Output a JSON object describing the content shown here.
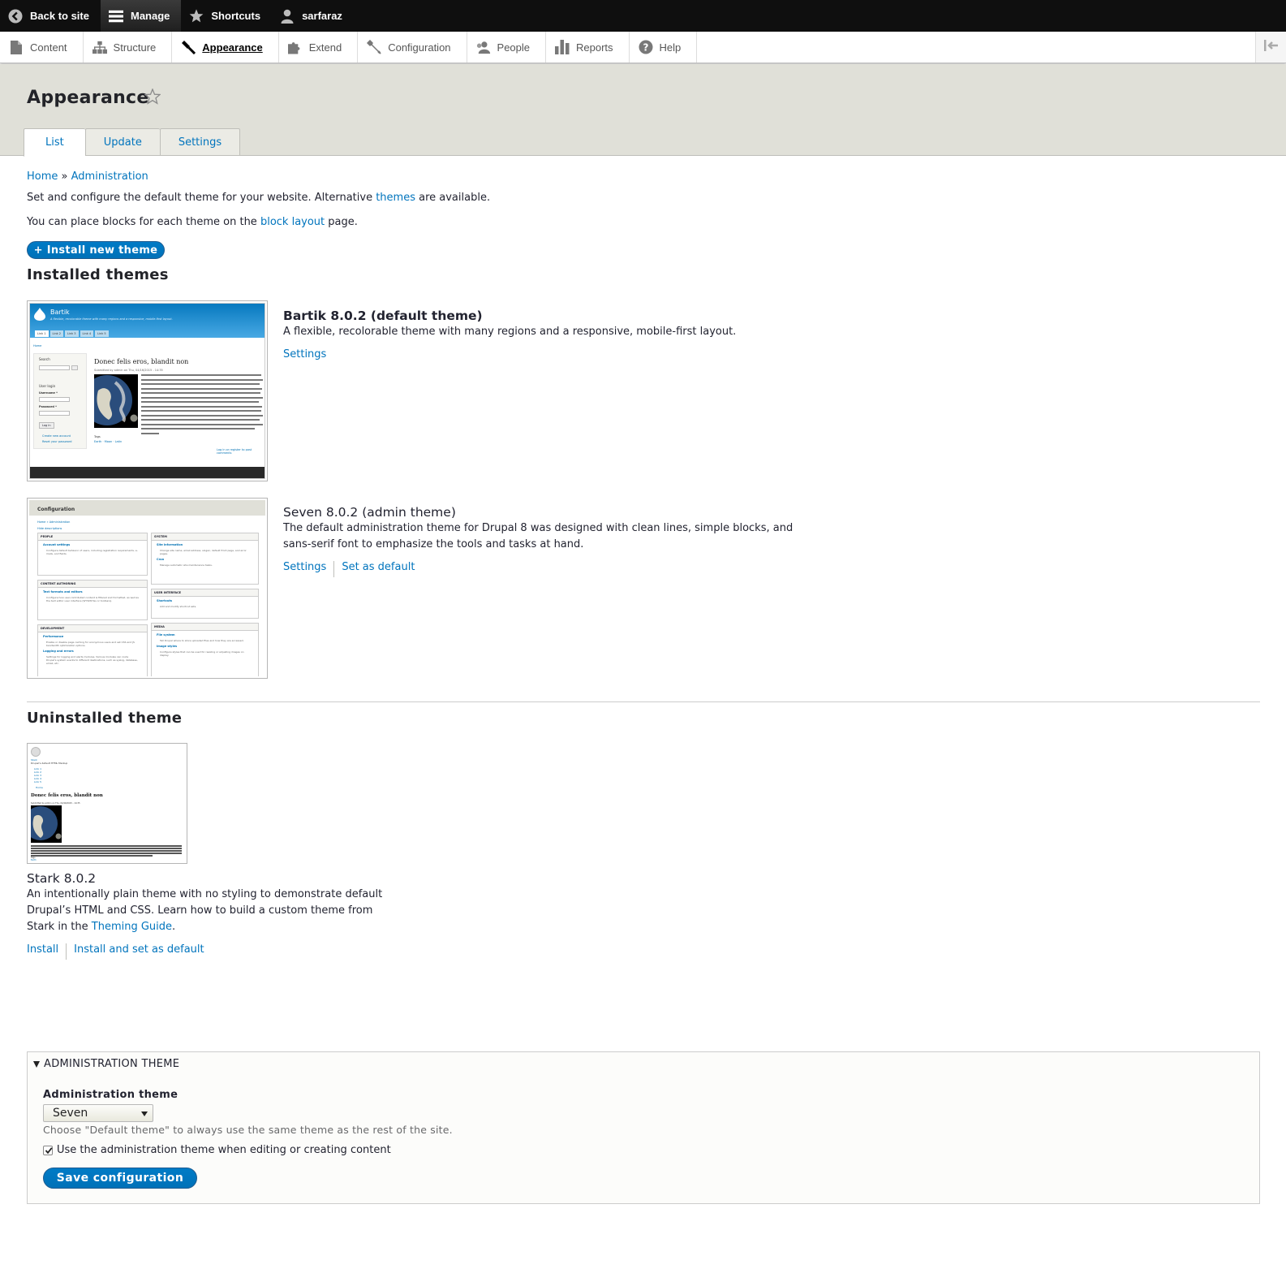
{
  "toolbar": {
    "back_label": "Back to site",
    "manage_label": "Manage",
    "shortcuts_label": "Shortcuts",
    "user_label": "sarfaraz"
  },
  "tray": {
    "items": [
      {
        "label": "Content",
        "icon": "file-icon"
      },
      {
        "label": "Structure",
        "icon": "sitemap-icon"
      },
      {
        "label": "Appearance",
        "icon": "paintbrush-icon",
        "active": true
      },
      {
        "label": "Extend",
        "icon": "puzzle-icon"
      },
      {
        "label": "Configuration",
        "icon": "wrench-icon"
      },
      {
        "label": "People",
        "icon": "person-icon"
      },
      {
        "label": "Reports",
        "icon": "bar-chart-icon"
      },
      {
        "label": "Help",
        "icon": "help-icon"
      }
    ]
  },
  "header": {
    "title": "Appearance",
    "tabs": [
      "List",
      "Update",
      "Settings"
    ]
  },
  "breadcrumb": {
    "home": "Home",
    "separator": "»",
    "admin": "Administration"
  },
  "intro": {
    "p1_before": "Set and configure the default theme for your website. Alternative ",
    "p1_link": "themes",
    "p1_after": " are available.",
    "p2_before": "You can place blocks for each theme on the ",
    "p2_link": "block layout",
    "p2_after": " page."
  },
  "install_button": "+ Install new theme",
  "installed": {
    "heading": "Installed themes",
    "themes": [
      {
        "name": "Bartik 8.0.2 (default theme)",
        "description": "A flexible, recolorable theme with many regions and a responsive, mobile-first layout.",
        "links": [
          "Settings"
        ]
      },
      {
        "name": "Seven 8.0.2 (admin theme)",
        "description_line1": "The default administration theme for Drupal 8 was designed with clean lines, simple blocks, and",
        "description_line2": "sans-serif font to emphasize the tools and tasks at hand.",
        "links": [
          "Settings",
          "Set as default"
        ]
      }
    ]
  },
  "bartik_preview": {
    "site_name": "Bartik",
    "slogan": "A flexible, recolorable theme with many regions and a responsive, mobile-first layout.",
    "tabs": [
      "Link 1",
      "Link 2",
      "Link 3",
      "Link 4",
      "Link 5"
    ],
    "crumb": "Home",
    "search": "Search",
    "login_title": "User login",
    "username": "Username *",
    "password": "Password *",
    "login_btn": "Log in",
    "create": "Create new account",
    "reset": "Reset your password",
    "article_title": "Donec felis eros, blandit non",
    "submitted": "Submitted by admin on Thu, 04/16/2015 - 14:35",
    "tags": "Tags",
    "tag_links": "Earth · Moon · Latin",
    "footer_link": "Log in or register to post comments"
  },
  "seven_preview": {
    "title": "Configuration",
    "crumb": "Home » Administration",
    "hide": "Hide descriptions",
    "left": [
      {
        "heading": "PEOPLE",
        "items": [
          {
            "t": "Account settings",
            "d": "Configure default behavior of users, including registration requirements, e-mails, and fields."
          }
        ]
      },
      {
        "heading": "CONTENT AUTHORING",
        "items": [
          {
            "t": "Text formats and editors",
            "d": "Configure how user-contributed content is filtered and formatted, as well as the text editor user interface (WYSIWYGs or toolbars)."
          }
        ]
      },
      {
        "heading": "DEVELOPMENT",
        "items": [
          {
            "t": "Performance",
            "d": "Enable or disable page caching for anonymous users and set CSS and JS bandwidth optimization options."
          },
          {
            "t": "Logging and errors",
            "d": "Settings for logging and alerts modules. Various modules can route Drupal's system events to different destinations, such as syslog, database, email, etc."
          }
        ]
      }
    ],
    "right": [
      {
        "heading": "SYSTEM",
        "items": [
          {
            "t": "Site information",
            "d": "Change site name, email address, slogan, default front page, and error pages."
          },
          {
            "t": "Cron",
            "d": "Manage automatic site maintenance tasks."
          }
        ]
      },
      {
        "heading": "USER INTERFACE",
        "items": [
          {
            "t": "Shortcuts",
            "d": "Add and modify shortcut sets."
          }
        ]
      },
      {
        "heading": "MEDIA",
        "items": [
          {
            "t": "File system",
            "d": "Tell Drupal where to store uploaded files and how they are accessed."
          },
          {
            "t": "Image styles",
            "d": "Configure styles that can be used for resizing or adjusting images on display."
          }
        ]
      }
    ]
  },
  "stark_preview": {
    "site": "Stark",
    "slogan": "Drupal's default HTML Markup",
    "nav": [
      "Link 1",
      "Link 2",
      "Link 3",
      "Link 4",
      "Link 5"
    ],
    "crumb": "Home",
    "title": "Donec felis eros, blandit non",
    "submitted": "Submitted by admin on Thu, 04/16/2015 - 14:35",
    "tags": "Tags",
    "tag": "Earth"
  },
  "uninstalled": {
    "heading": "Uninstalled theme",
    "theme": {
      "name": "Stark 8.0.2",
      "desc_line1": "An intentionally plain theme with no styling to demonstrate default",
      "desc_line2": "Drupal’s HTML and CSS. Learn how to build a custom theme from",
      "desc_line3_before": "Stark in the ",
      "desc_link": "Theming Guide",
      "desc_line3_after": ".",
      "links": [
        "Install",
        "Install and set as default"
      ]
    }
  },
  "admin_theme": {
    "legend": "ADMINISTRATION THEME",
    "label": "Administration theme",
    "selected": "Seven",
    "description": "Choose \"Default theme\" to always use the same theme as the rest of the site.",
    "checkbox_label": "Use the administration theme when editing or creating content",
    "checkbox_checked": true,
    "save": "Save configuration"
  }
}
